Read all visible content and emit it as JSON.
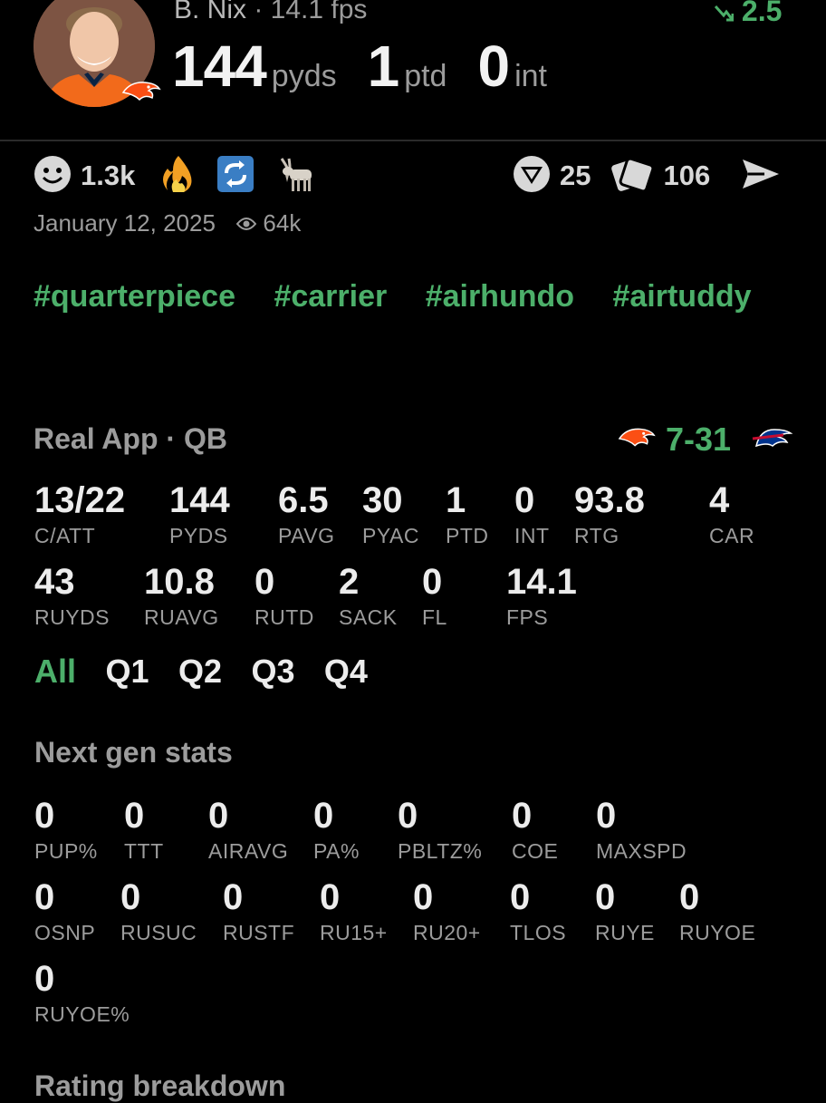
{
  "header": {
    "player_name": "B. Nix",
    "fps_text": "· 14.1 fps",
    "trend_value": "2.5",
    "stats": [
      {
        "value": "144",
        "unit": "pyds"
      },
      {
        "value": "1",
        "unit": "ptd"
      },
      {
        "value": "0",
        "unit": "int"
      }
    ]
  },
  "reactions": {
    "smile_count": "1.3k",
    "vote_count": "25",
    "cards_count": "106"
  },
  "meta": {
    "date": "January 12, 2025",
    "views": "64k"
  },
  "tags": [
    "#quarterpiece",
    "#carrier",
    "#airhundo",
    "#airtuddy"
  ],
  "game": {
    "title": "Real App · QB",
    "score_a": "7",
    "score_sep": "-",
    "score_b": "31",
    "colors": {
      "accent": "#4caf6a",
      "broncos": "#fb4f14",
      "bills": "#00338d"
    }
  },
  "box_stats": {
    "row1": [
      {
        "value": "13/22",
        "label": "C/ATT"
      },
      {
        "value": "144",
        "label": "PYDS"
      },
      {
        "value": "6.5",
        "label": "PAVG"
      },
      {
        "value": "30",
        "label": "PYAC"
      },
      {
        "value": "1",
        "label": "PTD"
      },
      {
        "value": "0",
        "label": "INT"
      },
      {
        "value": "93.8",
        "label": "RTG"
      },
      {
        "value": "4",
        "label": "CAR"
      }
    ],
    "row2": [
      {
        "value": "43",
        "label": "RUYDS"
      },
      {
        "value": "10.8",
        "label": "RUAVG"
      },
      {
        "value": "0",
        "label": "RUTD"
      },
      {
        "value": "2",
        "label": "SACK"
      },
      {
        "value": "0",
        "label": "FL"
      },
      {
        "value": "14.1",
        "label": "FPS"
      }
    ]
  },
  "quarter_tabs": [
    "All",
    "Q1",
    "Q2",
    "Q3",
    "Q4"
  ],
  "next_gen": {
    "title": "Next gen stats",
    "row1": [
      {
        "value": "0",
        "label": "PUP%"
      },
      {
        "value": "0",
        "label": "TTT"
      },
      {
        "value": "0",
        "label": "AIRAVG"
      },
      {
        "value": "0",
        "label": "PA%"
      },
      {
        "value": "0",
        "label": "PBLTZ%"
      },
      {
        "value": "0",
        "label": "COE"
      },
      {
        "value": "0",
        "label": "MAXSPD"
      }
    ],
    "row2": [
      {
        "value": "0",
        "label": "OSNP"
      },
      {
        "value": "0",
        "label": "RUSUC"
      },
      {
        "value": "0",
        "label": "RUSTF"
      },
      {
        "value": "0",
        "label": "RU15+"
      },
      {
        "value": "0",
        "label": "RU20+"
      },
      {
        "value": "0",
        "label": "TLOS"
      },
      {
        "value": "0",
        "label": "RUYE"
      },
      {
        "value": "0",
        "label": "RUYOE"
      }
    ],
    "row3": [
      {
        "value": "0",
        "label": "RUYOE%"
      }
    ]
  },
  "next_section_title": "Rating breakdown"
}
